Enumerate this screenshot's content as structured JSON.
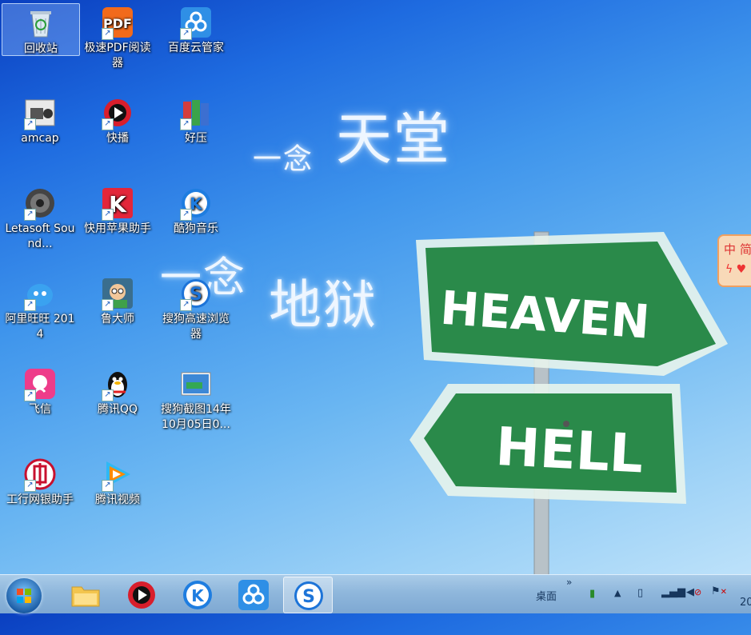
{
  "wallpaper": {
    "heaven_cn_prefix": "一念",
    "heaven_cn": "天堂",
    "hell_cn_prefix": "一念",
    "hell_cn": "地狱",
    "sign_heaven": "HEAVEN",
    "sign_hell": "HELL",
    "sign_color": "#2a8a4a"
  },
  "desktop_icons": [
    {
      "label": "回收站",
      "icon": "recycle-bin"
    },
    {
      "label": "极速PDF阅读器",
      "icon": "pdf-reader"
    },
    {
      "label": "百度云管家",
      "icon": "baidu-cloud"
    },
    {
      "label": "amcap",
      "icon": "amcap-camera"
    },
    {
      "label": "快播",
      "icon": "qvod-player"
    },
    {
      "label": "好压",
      "icon": "haozip-books"
    },
    {
      "label": "Letasoft Sound...",
      "icon": "speaker"
    },
    {
      "label": "快用苹果助手",
      "icon": "kuaiyong-k"
    },
    {
      "label": "酷狗音乐",
      "icon": "kugou-k"
    },
    {
      "label": "阿里旺旺 2014",
      "icon": "aliwangwang"
    },
    {
      "label": "鲁大师",
      "icon": "ludashi"
    },
    {
      "label": "搜狗高速浏览器",
      "icon": "sogou-browser"
    },
    {
      "label": "飞信",
      "icon": "fetion"
    },
    {
      "label": "腾讯QQ",
      "icon": "qq-penguin"
    },
    {
      "label": "搜狗截图14年10月05日0...",
      "icon": "screenshot-file"
    },
    {
      "label": "工行网银助手",
      "icon": "icbc"
    },
    {
      "label": "腾讯视频",
      "icon": "tencent-video"
    }
  ],
  "ime": {
    "mode": "中",
    "variant": "简"
  },
  "taskbar": {
    "pinned": [
      "file-explorer",
      "qvod-player",
      "kugou",
      "baidu-cloud",
      "sogou-browser"
    ],
    "desktop_label": "桌面",
    "clock_partial": "20"
  }
}
